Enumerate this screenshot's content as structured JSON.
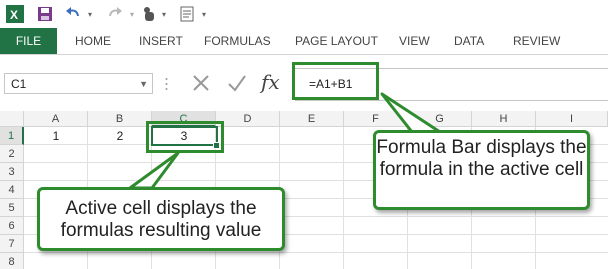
{
  "ribbon": {
    "file_label": "FILE",
    "tabs": [
      "HOME",
      "INSERT",
      "FORMULAS",
      "PAGE LAYOUT",
      "VIEW",
      "DATA",
      "REVIEW"
    ]
  },
  "formula_bar": {
    "name_box": "C1",
    "fx_label": "fx",
    "formula": "=A1+B1"
  },
  "sheet": {
    "columns": [
      "A",
      "B",
      "C",
      "D",
      "E",
      "F",
      "G",
      "H",
      "I"
    ],
    "rows": [
      "1",
      "2",
      "3",
      "4",
      "5",
      "6",
      "7",
      "8"
    ],
    "cells": {
      "A1": "1",
      "B1": "2",
      "C1": "3"
    },
    "selected_cell": "C1"
  },
  "callouts": {
    "active_cell": "Active cell displays the formulas resulting value",
    "formula_bar": "Formula Bar displays the formula in the active cell"
  },
  "colors": {
    "accent": "#217346",
    "callout_border": "#2e8b2e"
  }
}
